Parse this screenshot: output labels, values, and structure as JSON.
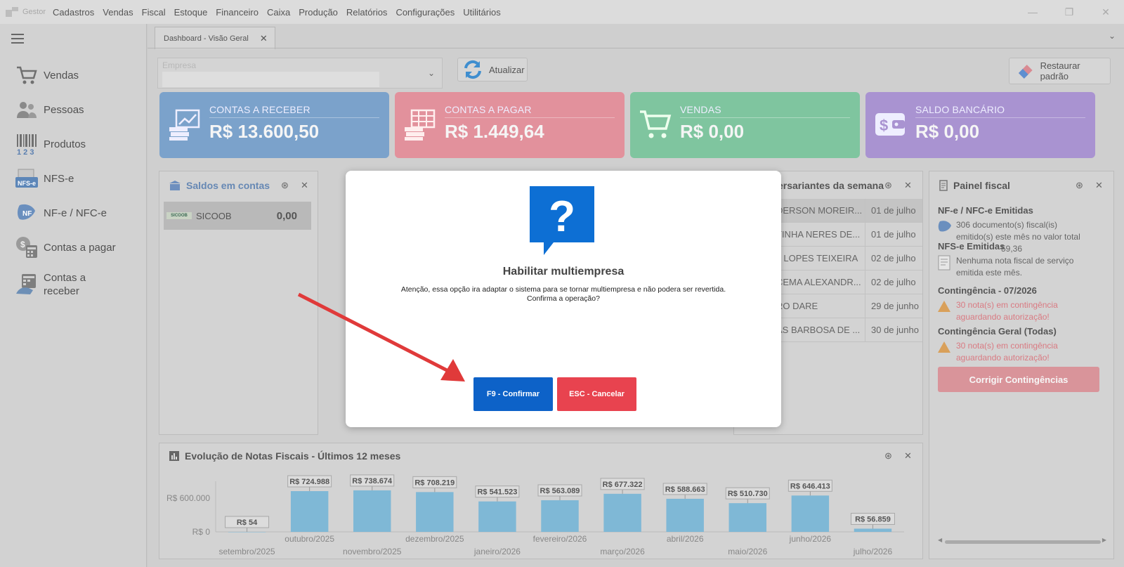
{
  "titlebar": {
    "app_name": "Gestor",
    "menu": [
      "Cadastros",
      "Vendas",
      "Fiscal",
      "Estoque",
      "Financeiro",
      "Caixa",
      "Produção",
      "Relatórios",
      "Configurações",
      "Utilitários"
    ]
  },
  "sidebar": {
    "items": [
      {
        "label": "Vendas",
        "icon": "cart-icon"
      },
      {
        "label": "Pessoas",
        "icon": "people-icon"
      },
      {
        "label": "Produtos",
        "icon": "barcode-icon"
      },
      {
        "label": "NFS-e",
        "icon": "nfse-icon"
      },
      {
        "label": "NF-e / NFC-e",
        "icon": "nfe-icon"
      },
      {
        "label": "Contas a pagar",
        "icon": "accounts-payable-icon"
      },
      {
        "label": "Contas a receber",
        "icon": "accounts-receivable-icon"
      }
    ]
  },
  "tabs": {
    "active": "Dashboard - Visão Geral",
    "close": "✕"
  },
  "toolbar": {
    "empresa_label": "Empresa",
    "empresa_value": "",
    "atualizar": "Atualizar",
    "restaurar": "Restaurar padrão"
  },
  "cards": [
    {
      "title": "CONTAS A RECEBER",
      "value": "R$ 13.600,50",
      "color": "#7ba2cb"
    },
    {
      "title": "CONTAS A PAGAR",
      "value": "R$ 1.449,64",
      "color": "#e2919c"
    },
    {
      "title": "VENDAS",
      "value": "R$ 0,00",
      "color": "#7fc59f"
    },
    {
      "title": "SALDO BANCÁRIO",
      "value": "R$ 0,00",
      "color": "#a993d1"
    }
  ],
  "saldos": {
    "title": "Saldos em contas",
    "rows": [
      {
        "bank": "SICOOB",
        "logo_text": "SICOOB",
        "value": "0,00"
      }
    ]
  },
  "aniversariantes": {
    "title": "ersariantes da semana",
    "rows": [
      {
        "name": "DERSON MOREIR...",
        "date": "01 de julho"
      },
      {
        "name": "TINHA NERES DE...",
        "date": "01 de julho"
      },
      {
        "name": "L LOPES TEIXEIRA",
        "date": "02 de julho"
      },
      {
        "name": "CEMA ALEXANDR...",
        "date": "02 de julho"
      },
      {
        "name": "RO DARE",
        "date": "29 de junho"
      },
      {
        "name": "AS BARBOSA DE ...",
        "date": "30 de junho"
      }
    ]
  },
  "fiscal": {
    "title": "Painel fiscal",
    "nfe_heading": "NF-e / NFC-e Emitidas",
    "nfe_text": "306 documento(s) fiscal(is) emitido(s) este mês no valor total",
    "nfe_value_fragment": "59,36",
    "nfse_heading": "NFS-e Emitidas",
    "nfse_text": "Nenhuma nota fiscal de serviço emitida este mês.",
    "contingencia_heading": "Contingência - 07/2026",
    "contingencia_text": "30 nota(s) em contingência aguardando autorização!",
    "contingencia_geral_heading": "Contingência Geral (Todas)",
    "contingencia_geral_text": "30 nota(s) em contingência aguardando autorização!",
    "button": "Corrigir Contingências"
  },
  "chart_panel": {
    "title": "Evolução de Notas Fiscais - Últimos 12 meses"
  },
  "chart_data": {
    "type": "bar",
    "categories": [
      "setembro/2025",
      "outubro/2025",
      "novembro/2025",
      "dezembro/2025",
      "janeiro/2026",
      "fevereiro/2026",
      "março/2026",
      "abril/2026",
      "maio/2026",
      "junho/2026",
      "julho/2026"
    ],
    "values": [
      54,
      724988,
      738674,
      708219,
      541523,
      563089,
      677322,
      588663,
      510730,
      646413,
      56859
    ],
    "labels": [
      "R$ 54",
      "R$ 724.988",
      "R$ 738.674",
      "R$ 708.219",
      "R$ 541.523",
      "R$ 563.089",
      "R$ 677.322",
      "R$ 588.663",
      "R$ 510.730",
      "R$ 646.413",
      "R$ 56.859"
    ],
    "y_ticks": [
      {
        "value": 0,
        "label": "R$ 0"
      },
      {
        "value": 600000,
        "label": "R$ 600.000"
      }
    ],
    "bar_color": "#7fb8d6"
  },
  "modal": {
    "title": "Habilitar multiempresa",
    "message_line1": "Atenção, essa opção ira adaptar o sistema para se tornar multiempresa e não podera ser revertida.",
    "message_line2": "Confirma a operação?",
    "confirm": "F9 - Confirmar",
    "cancel": "ESC - Cancelar",
    "icon": "question-icon",
    "icon_color": "#0d6fd4"
  },
  "annotation": {
    "arrow_color": "#e03a3a"
  }
}
